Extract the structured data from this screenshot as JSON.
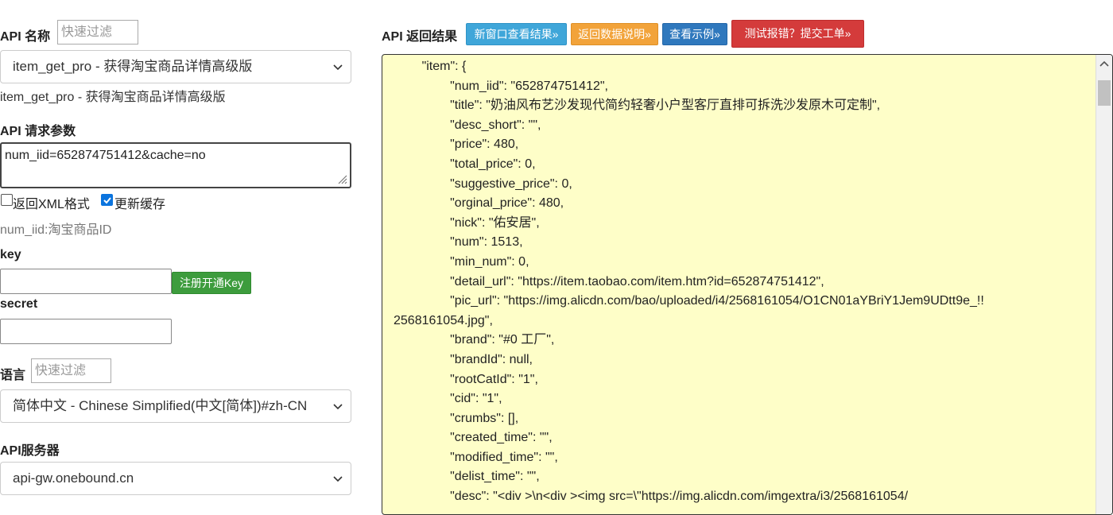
{
  "left": {
    "api_name_label": "API 名称",
    "api_name_filter_placeholder": "快速过滤",
    "api_select_value": "item_get_pro - 获得淘宝商品详情高级版",
    "api_desc": "item_get_pro - 获得淘宝商品详情高级版",
    "params_label": "API 请求参数",
    "params_value": "num_iid=652874751412&cache=no",
    "xml_checkbox_label": "返回XML格式",
    "xml_checked": false,
    "cache_checkbox_label": "更新缓存",
    "cache_checked": true,
    "param_hint": "num_iid:淘宝商品ID",
    "key_label": "key",
    "key_value": "",
    "register_button": "注册开通Key",
    "secret_label": "secret",
    "secret_value": "",
    "lang_label": "语言",
    "lang_filter_placeholder": "快速过滤",
    "lang_select_value": "简体中文 - Chinese Simplified(中文[简体])#zh-CN",
    "server_label": "API服务器",
    "server_select_value": "api-gw.onebound.cn"
  },
  "right": {
    "result_label": "API 返回结果",
    "btn_new_window": "新窗口查看结果»",
    "btn_data_desc": "返回数据说明»",
    "btn_example": "查看示例»",
    "btn_report": "测试报错？提交工单»",
    "result_lines": [
      "        \"item\": {",
      "                \"num_iid\": \"652874751412\",",
      "                \"title\": \"奶油风布艺沙发现代简约轻奢小户型客厅直排可拆洗沙发原木可定制\",",
      "                \"desc_short\": \"\",",
      "                \"price\": 480,",
      "                \"total_price\": 0,",
      "                \"suggestive_price\": 0,",
      "                \"orginal_price\": 480,",
      "                \"nick\": \"佑安居\",",
      "                \"num\": 1513,",
      "                \"min_num\": 0,",
      "                \"detail_url\": \"https://item.taobao.com/item.htm?id=652874751412\",",
      "                \"pic_url\": \"https://img.alicdn.com/bao/uploaded/i4/2568161054/O1CN01aYBriY1Jem9UDtt9e_!!",
      "2568161054.jpg\",",
      "                \"brand\": \"#0 工厂\",",
      "                \"brandId\": null,",
      "                \"rootCatId\": \"1\",",
      "                \"cid\": \"1\",",
      "                \"crumbs\": [],",
      "                \"created_time\": \"\",",
      "                \"modified_time\": \"\",",
      "                \"delist_time\": \"\",",
      "                \"desc\": \"<div >\\n<div ><img src=\\\"https://img.alicdn.com/imgextra/i3/2568161054/"
    ]
  }
}
